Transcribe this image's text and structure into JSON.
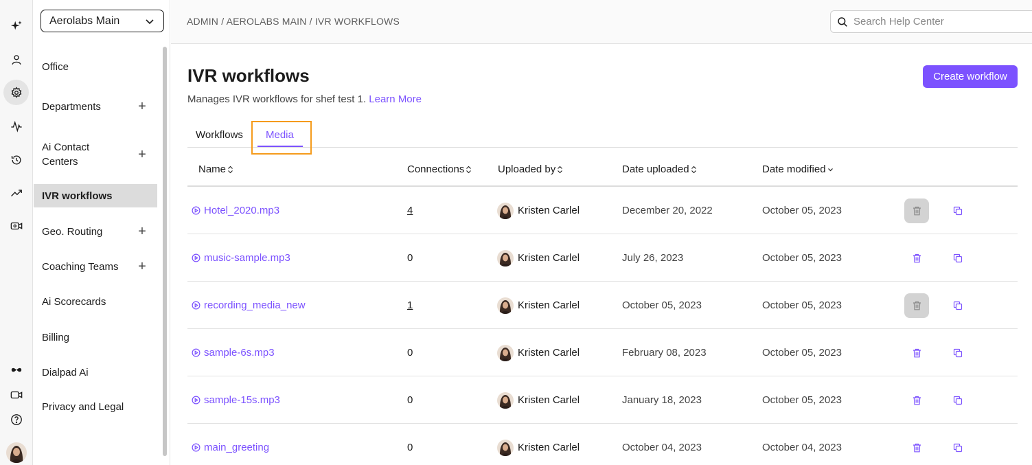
{
  "org_select": {
    "label": "Aerolabs Main"
  },
  "breadcrumb": "ADMIN / AEROLABS MAIN / IVR WORKFLOWS",
  "search": {
    "placeholder": "Search Help Center"
  },
  "sidebar": {
    "items": [
      {
        "label": "Office"
      },
      {
        "label": "Departments"
      },
      {
        "label": "Ai Contact\nCenters"
      },
      {
        "label": "IVR workflows"
      },
      {
        "label": "Geo. Routing"
      },
      {
        "label": "Coaching Teams"
      },
      {
        "label": "Ai Scorecards"
      },
      {
        "label": "Billing"
      },
      {
        "label": "Dialpad Ai"
      },
      {
        "label": "Privacy and Legal"
      }
    ]
  },
  "rail": {
    "icons": [
      "sparkle-icon",
      "person-icon",
      "gear-icon",
      "activity-icon",
      "history-icon",
      "trend-icon",
      "video-settings-icon",
      "dialpad-logo-icon",
      "video-icon",
      "help-icon"
    ],
    "active": "gear-icon"
  },
  "page": {
    "title": "IVR workflows",
    "subtitle": "Manages IVR workflows for shef test 1.",
    "learn_more": "Learn More",
    "create_button": "Create workflow"
  },
  "tabs": [
    {
      "label": "Workflows",
      "active": false
    },
    {
      "label": "Media",
      "active": true
    }
  ],
  "table": {
    "columns": [
      "Name",
      "Connections",
      "Uploaded by",
      "Date uploaded",
      "Date modified"
    ],
    "rows": [
      {
        "name": "Hotel_2020.mp3",
        "connections": "4",
        "uploaded_by": "Kristen Carlel",
        "date_uploaded": "December 20, 2022",
        "date_modified": "October 05, 2023",
        "delete_disabled": true
      },
      {
        "name": "music-sample.mp3",
        "connections": "0",
        "uploaded_by": "Kristen Carlel",
        "date_uploaded": "July 26, 2023",
        "date_modified": "October 05, 2023",
        "delete_disabled": false
      },
      {
        "name": "recording_media_new",
        "connections": "1",
        "uploaded_by": "Kristen Carlel",
        "date_uploaded": "October 05, 2023",
        "date_modified": "October 05, 2023",
        "delete_disabled": true
      },
      {
        "name": "sample-6s.mp3",
        "connections": "0",
        "uploaded_by": "Kristen Carlel",
        "date_uploaded": "February 08, 2023",
        "date_modified": "October 05, 2023",
        "delete_disabled": false
      },
      {
        "name": "sample-15s.mp3",
        "connections": "0",
        "uploaded_by": "Kristen Carlel",
        "date_uploaded": "January 18, 2023",
        "date_modified": "October 05, 2023",
        "delete_disabled": false
      },
      {
        "name": "main_greeting",
        "connections": "0",
        "uploaded_by": "Kristen Carlel",
        "date_uploaded": "October 04, 2023",
        "date_modified": "October 04, 2023",
        "delete_disabled": false
      }
    ]
  },
  "colors": {
    "accent": "#7c52ff",
    "highlight": "#f59b1c"
  }
}
